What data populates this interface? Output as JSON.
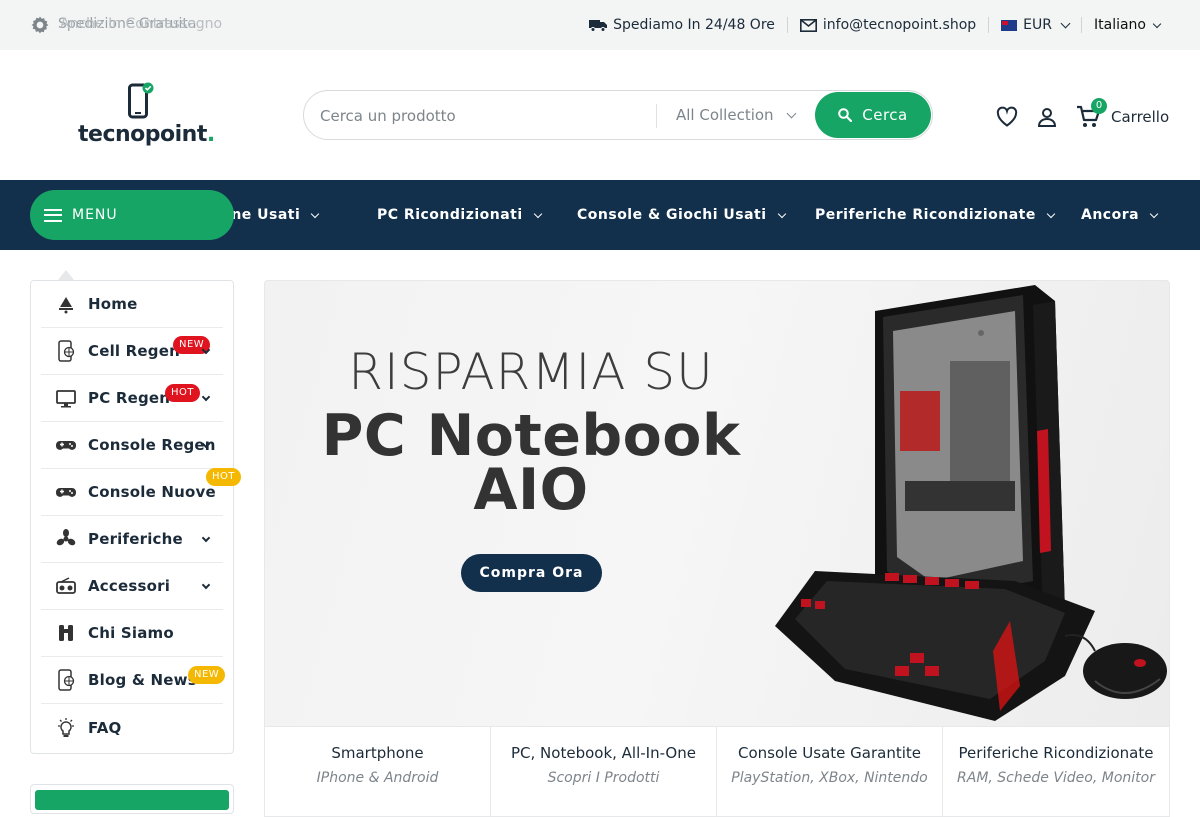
{
  "topbar": {
    "promo_text": "Spedizione Gratuita",
    "promo_text_overlay": "Anche In Contrassegno",
    "shipping": "Spediamo In 24/48 Ore",
    "email": "info@tecnopoint.shop",
    "currency": "EUR",
    "language": "Italiano"
  },
  "header": {
    "logo_text": "tecnopoint",
    "logo_dot": ".",
    "search_placeholder": "Cerca un prodotto",
    "collection": "All Collection",
    "search_button": "Cerca",
    "cart_count": "0",
    "cart_label": "Carrello"
  },
  "navbar": {
    "menu_label": "MENU",
    "links": [
      "Smartphone Usati",
      "PC Ricondizionati",
      "Console & Giochi Usati",
      "Periferiche Ricondizionate",
      "Ancora"
    ]
  },
  "sidebar": {
    "items": [
      {
        "label": "Home",
        "icon": "home-icon"
      },
      {
        "label": "Cell Regen",
        "icon": "phone-icon",
        "tag": "NEW"
      },
      {
        "label": "PC Regen",
        "icon": "monitor-icon",
        "tag": "HOT"
      },
      {
        "label": "Console Regen",
        "icon": "gamepad-icon"
      },
      {
        "label": "Console Nuove",
        "icon": "gamepad-icon",
        "tag": "HOT"
      },
      {
        "label": "Periferiche",
        "icon": "fan-icon"
      },
      {
        "label": "Accessori",
        "icon": "radio-icon"
      },
      {
        "label": "Chi Siamo",
        "icon": "binoculars-icon"
      },
      {
        "label": "Blog & News",
        "icon": "phone-icon",
        "tag": "NEW"
      },
      {
        "label": "FAQ",
        "icon": "lightbulb-icon"
      }
    ]
  },
  "banner": {
    "subtitle": "RISPARMIA SU",
    "title_line1": "PC Notebook",
    "title_line2": "AIO",
    "button": "Compra Ora"
  },
  "categories": [
    {
      "title": "Smartphone",
      "subtitle": "IPhone & Android"
    },
    {
      "title": "PC, Notebook, All-In-One",
      "subtitle": "Scopri I Prodotti"
    },
    {
      "title": "Console Usate Garantite",
      "subtitle": "PlayStation, XBox, Nintendo"
    },
    {
      "title": "Periferiche Ricondizionate",
      "subtitle": "RAM, Schede Video, Monitor"
    }
  ],
  "colors": {
    "brand_green": "#17a566",
    "navy": "#122f4b",
    "tag_red": "#e0141e",
    "tag_yellow": "#f5b800"
  }
}
